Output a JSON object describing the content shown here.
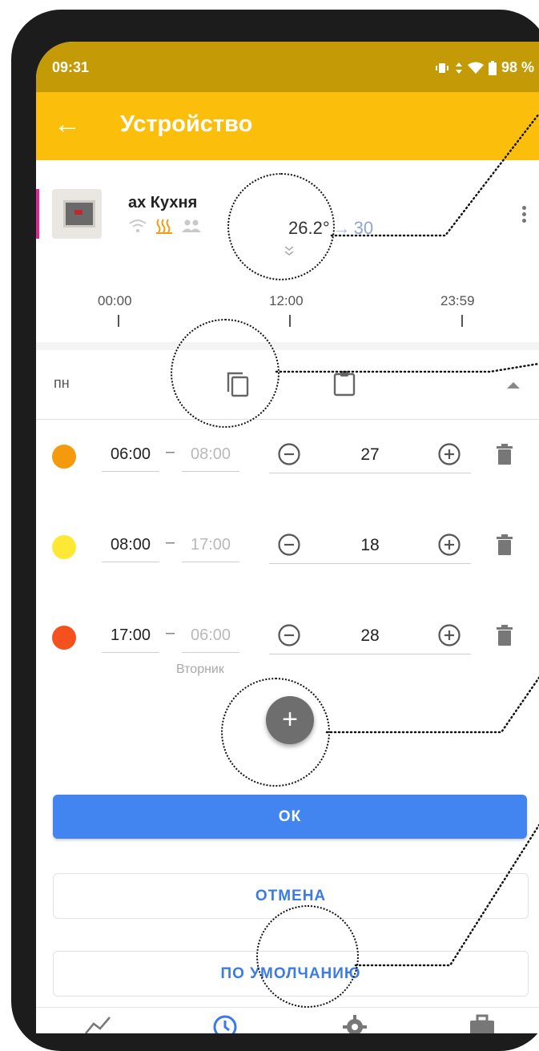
{
  "status_bar": {
    "time": "09:31",
    "battery": "98 %"
  },
  "app_bar": {
    "title": "Устройство",
    "back_icon": "arrow-left-icon"
  },
  "device": {
    "name": "ах Кухня",
    "current_temp": "26.2°",
    "arrow": "→",
    "target_temp": "30",
    "heating_color": "#f39c12"
  },
  "timeline": {
    "labels": [
      "00:00",
      "12:00",
      "23:59"
    ]
  },
  "day": {
    "label": "пн"
  },
  "slots": [
    {
      "color": "#f59a0c",
      "start": "06:00",
      "dash": "–",
      "end": "08:00",
      "temp": "27",
      "end_day": ""
    },
    {
      "color": "#fde935",
      "start": "08:00",
      "dash": "–",
      "end": "17:00",
      "temp": "18",
      "end_day": ""
    },
    {
      "color": "#f4511e",
      "start": "17:00",
      "dash": "–",
      "end": "06:00",
      "temp": "28",
      "end_day": "Вторник"
    }
  ],
  "add_button": {
    "symbol": "+"
  },
  "buttons": {
    "ok": "ОК",
    "cancel": "ОТМЕНА",
    "default": "ПО УМОЛЧАНИЮ"
  },
  "colors": {
    "status_bar": "#c49a07",
    "app_bar": "#fbbf0b",
    "primary": "#4285f0"
  }
}
